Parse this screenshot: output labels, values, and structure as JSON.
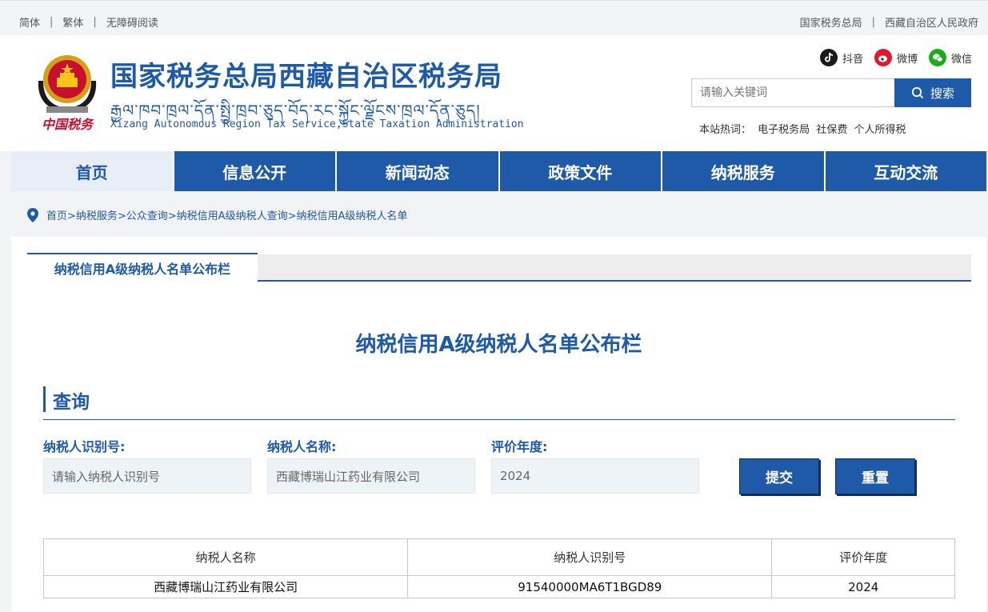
{
  "topbar": {
    "left": [
      "简体",
      "繁体",
      "无障碍阅读"
    ],
    "right": [
      "国家税务总局",
      "西藏自治区人民政府"
    ],
    "separator": "|"
  },
  "header": {
    "title_cn": "国家税务总局西藏自治区税务局",
    "title_tibetan": "རྒྱལ་ཁབ་ཁྲལ་དོན་སྤྱི་ཁྲབ་ཅུད་བོད་རང་སྐྱོང་ལྗོངས་ཁྲལ་དོན་ཅུད།",
    "title_en": "Xizang Autonomous Region Tax Service,State Taxation Administration",
    "calligraphy": "中国税务"
  },
  "social": [
    {
      "label": "抖音",
      "icon": "douyin-icon"
    },
    {
      "label": "微博",
      "icon": "weibo-icon"
    },
    {
      "label": "微信",
      "icon": "wechat-icon"
    }
  ],
  "search": {
    "placeholder": "请输入关键词",
    "button": "搜索"
  },
  "hot": {
    "label": "本站热词：",
    "terms": [
      "电子税务局",
      "社保费",
      "个人所得税"
    ]
  },
  "nav": [
    "首页",
    "信息公开",
    "新闻动态",
    "政策文件",
    "纳税服务",
    "互动交流"
  ],
  "breadcrumb": "首页>纳税服务>公众查询>纳税信用A级纳税人查询>纳税信用A级纳税人名单",
  "column_tab": "纳税信用A级纳税人名单公布栏",
  "page_title": "纳税信用A级纳税人名单公布栏",
  "query": {
    "heading": "查询",
    "fields": [
      {
        "label": "纳税人识别号:",
        "value": "请输入纳税人识别号"
      },
      {
        "label": "纳税人名称:",
        "value": "西藏博瑞山江药业有限公司"
      },
      {
        "label": "评价年度:",
        "value": "2024"
      }
    ],
    "submit": "提交",
    "reset": "重置"
  },
  "table": {
    "headers": [
      "纳税人名称",
      "纳税人识别号",
      "评价年度"
    ],
    "rows": [
      [
        "西藏博瑞山江药业有限公司",
        "91540000MA6T1BGD89",
        "2024"
      ]
    ]
  },
  "colors": {
    "brand": "#1e5aa8",
    "accent_red": "#c8102e"
  }
}
